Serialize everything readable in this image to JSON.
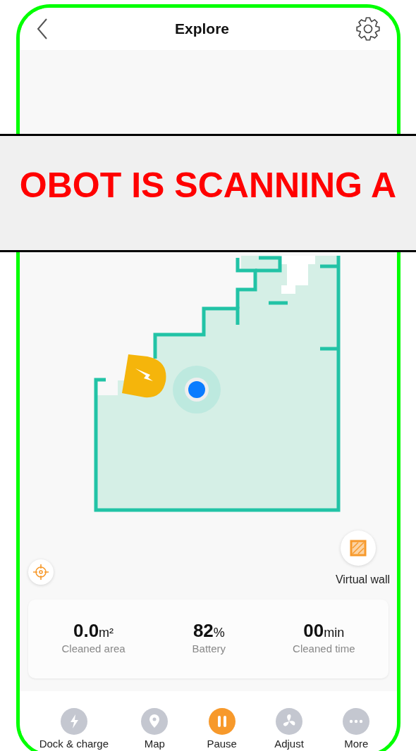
{
  "header": {
    "title": "Explore"
  },
  "banner": {
    "text": "OBOT IS SCANNING A"
  },
  "map_controls": {
    "virtual_wall_label": "Virtual wall"
  },
  "stats": [
    {
      "value": "0.0",
      "unit": "m²",
      "label": "Cleaned area"
    },
    {
      "value": "82",
      "unit": "%",
      "label": "Battery"
    },
    {
      "value": "00",
      "unit": "min",
      "label": "Cleaned time"
    }
  ],
  "bottom_nav": [
    {
      "kind": "dock",
      "label": "Dock & charge",
      "active": false
    },
    {
      "kind": "map",
      "label": "Map",
      "active": false
    },
    {
      "kind": "pause",
      "label": "Pause",
      "active": true
    },
    {
      "kind": "adjust",
      "label": "Adjust",
      "active": false
    },
    {
      "kind": "more",
      "label": "More",
      "active": false
    }
  ]
}
